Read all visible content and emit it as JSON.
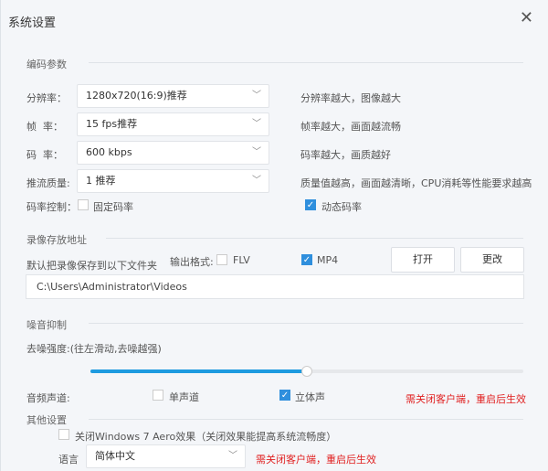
{
  "title": "系统设置",
  "encoding": {
    "section": "编码参数",
    "resolution": {
      "label": "分辨率：",
      "value": "1280x720(16:9)推荐",
      "hint": "分辨率越大，图像越大"
    },
    "framerate": {
      "label": "帧  率：",
      "value": "15 fps推荐",
      "hint": "帧率越大，画面越流畅"
    },
    "bitrate": {
      "label": "码  率：",
      "value": "600 kbps",
      "hint": "码率越大，画质越好"
    },
    "quality": {
      "label": "推流质量:",
      "value": "1 推荐",
      "hint": "质量值越高，画面越清晰，CPU消耗等性能要求越高"
    },
    "rate_control": {
      "label": "码率控制：",
      "fixed": "固定码率",
      "fixed_checked": false,
      "dynamic": "动态码率",
      "dynamic_checked": true
    }
  },
  "recording": {
    "section": "录像存放地址",
    "desc": "默认把录像保存到以下文件夹",
    "format_label": "输出格式:",
    "flv": "FLV",
    "flv_checked": false,
    "mp4": "MP4",
    "mp4_checked": true,
    "open": "打开",
    "change": "更改",
    "path": "C:\\Users\\Administrator\\Videos"
  },
  "noise": {
    "section": "噪音抑制",
    "label": "去噪强度:(往左滑动,去噪越强)",
    "level": 0.5
  },
  "audio": {
    "label": "音频声道:",
    "mono": "单声道",
    "mono_checked": false,
    "stereo": "立体声",
    "stereo_checked": true,
    "note": "需关闭客户端，重启后生效"
  },
  "other": {
    "section": "其他设置",
    "aero": "关闭Windows 7 Aero效果（关闭效果能提高系统流畅度）",
    "aero_checked": false,
    "lang_label": "语言",
    "lang_value": "简体中文",
    "lang_note": "需关闭客户端，重启后生效"
  },
  "colors": {
    "accent": "#1e9be0",
    "warning": "#e02020"
  }
}
